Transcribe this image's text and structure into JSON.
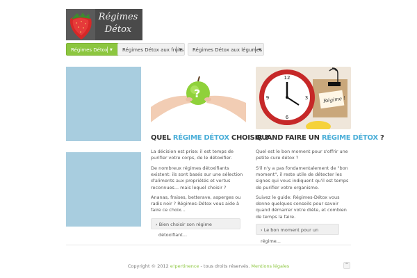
{
  "logo": {
    "line1": "Régimes",
    "line2": "Détox"
  },
  "nav": [
    {
      "label": "Régimes Détox"
    },
    {
      "label": "Régimes Détox aux fruits"
    },
    {
      "label": "Régimes Détox aux légumes"
    }
  ],
  "colors": {
    "accent_green": "#8cc63f",
    "title_blue": "#4aaed8",
    "placeholder_blue": "#a8cddf"
  },
  "cards": [
    {
      "title_pre": "Quel ",
      "title_hl": "régime détox",
      "title_post": " choisir ?",
      "paragraphs": [
        "La décision est prise: il est temps de purifier votre corps, de le détoxifier.",
        "De nombreux régimes détoxifiants existent: ils sont basés sur une sélection d'aliments aux propriétés et vertus reconnues... mais lequel choisir ?",
        "Ananas, fraises, betterave, asperges ou radis noir ? Régimes-Détox vous aide à faire ce choix..."
      ],
      "link_line1": "Bien choisir son régime",
      "link_line2": "détoxifiant..."
    },
    {
      "title_pre": "Quand faire un ",
      "title_hl": "régime détox",
      "title_post": " ?",
      "paragraphs": [
        "Quel est le bon moment pour s'offrir une petite cure détox ?",
        "S'il n'y a pas fondamentalement de \"bon moment\", il reste utile de détecter les signes qui vous indiquent qu'il est temps de purifier votre organisme.",
        "Suivez le guide: Régimes-Détox vous donne quelques conseils pour savoir quand démarrer votre diète, et combien de temps la faire."
      ],
      "link_line1": "Le bon moment pour un régime..."
    }
  ],
  "footer": {
    "prefix": "Copyright © 2012 ",
    "company": "e!pertinence",
    "middle": " - tous droits réservés. ",
    "legal": "Mentions légales"
  }
}
